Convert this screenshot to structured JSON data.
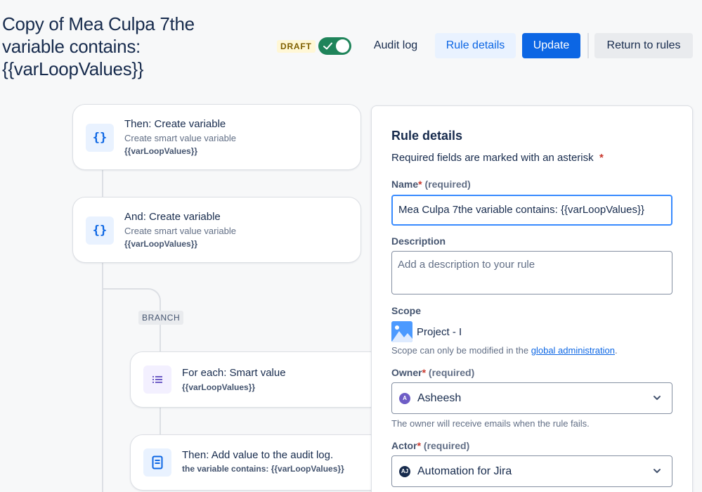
{
  "header": {
    "title": "Copy of Mea Culpa 7the variable contains: {{varLoopValues}}",
    "draft_badge": "DRAFT",
    "toggle_on": true,
    "audit_log": "Audit log",
    "rule_details": "Rule details",
    "update": "Update",
    "return_to_rules": "Return to rules"
  },
  "flow": {
    "cards": [
      {
        "title": "Then: Create variable",
        "sub": "Create smart value variable",
        "value": "{{varLoopValues}}",
        "icon": "curly-braces-icon"
      },
      {
        "title": "And: Create variable",
        "sub": "Create smart value variable",
        "value": "{{varLoopValues}}",
        "icon": "curly-braces-icon"
      },
      {
        "title": "For each: Smart value",
        "value": "{{varLoopValues}}",
        "icon": "list-icon"
      },
      {
        "title": "Then: Add value to the audit log.",
        "value": "the variable contains: {{varLoopValues}}",
        "icon": "document-icon"
      }
    ],
    "branch_label": "BRANCH"
  },
  "panel": {
    "title": "Rule details",
    "required_note": "Required fields are marked with an asterisk",
    "asterisk": "*",
    "name_label": "Name",
    "required_text": "(required)",
    "name_value": "Mea Culpa 7the variable contains: {{varLoopValues}}",
    "description_label": "Description",
    "description_placeholder": "Add a description to your rule",
    "scope_label": "Scope",
    "scope_value": "Project - I",
    "scope_help_prefix": "Scope can only be modified in the ",
    "scope_help_link": "global administration",
    "scope_help_suffix": ".",
    "owner_label": "Owner",
    "owner_initial": "A",
    "owner_value": "Asheesh",
    "owner_help": "The owner will receive emails when the rule fails.",
    "actor_label": "Actor",
    "actor_initials": "AJ",
    "actor_value": "Automation for Jira"
  },
  "colors": {
    "primary": "#0c66e4",
    "toggle_on": "#1f845a",
    "draft_bg": "#fff7d6",
    "owner_avatar": "#6e5dc6",
    "actor_avatar": "#172b4d"
  }
}
